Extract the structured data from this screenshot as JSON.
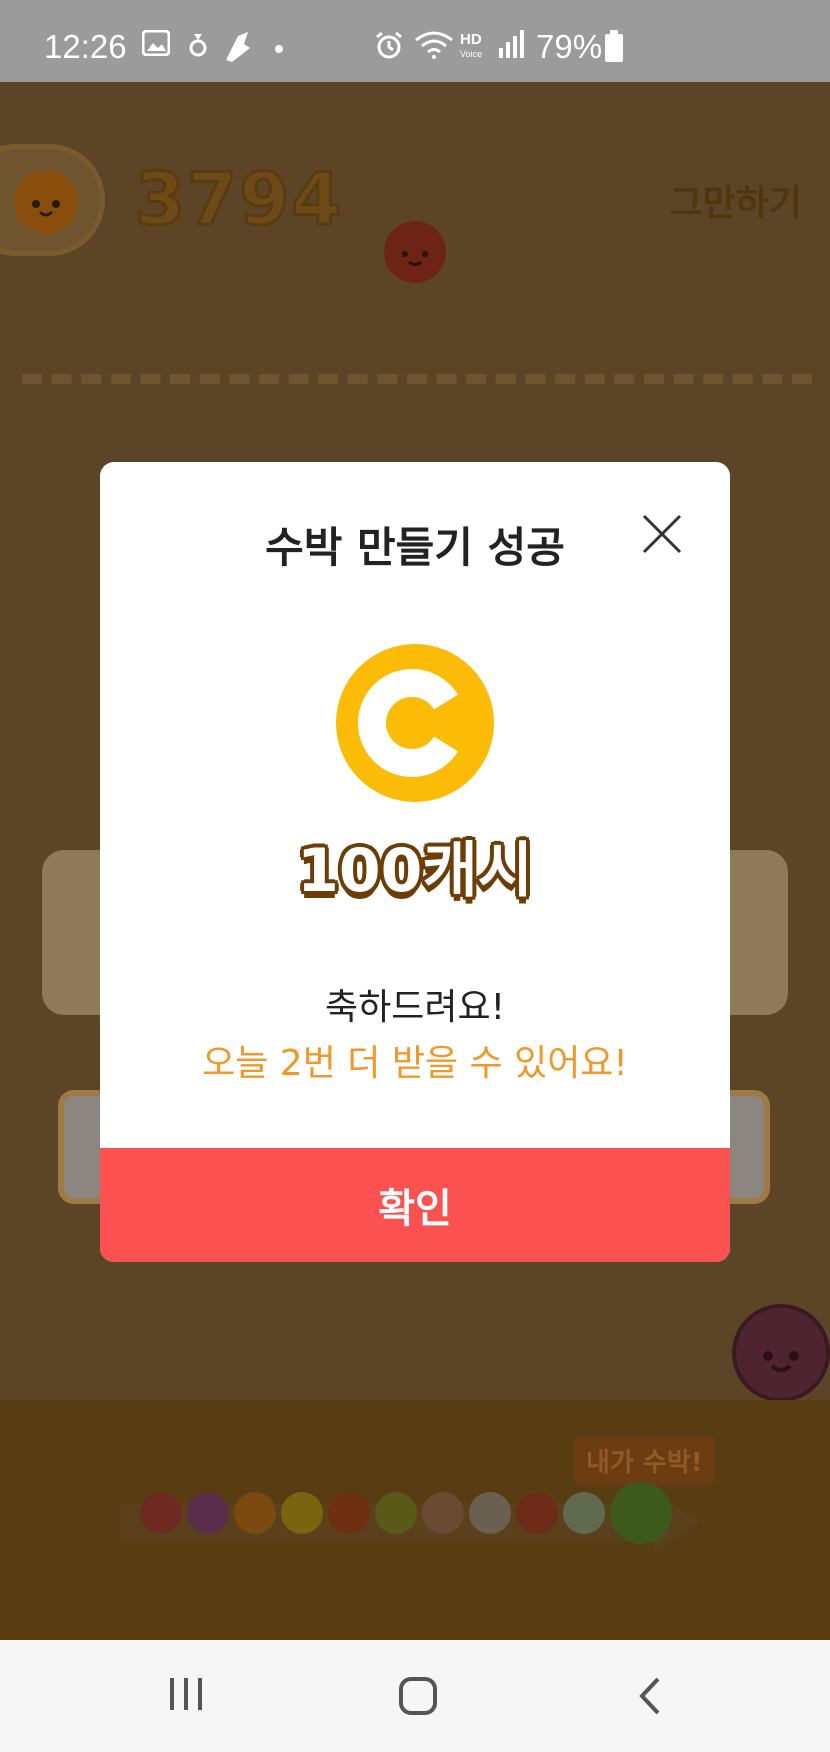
{
  "status_bar": {
    "time": "12:26",
    "battery": "79%",
    "icons": [
      "gallery-icon",
      "notification-icon",
      "app-icon",
      "dot-icon",
      "alarm-icon",
      "wifi-icon",
      "hd-voice-icon",
      "signal-icon",
      "battery-icon"
    ]
  },
  "game": {
    "score": "3794",
    "quit_label": "그만하기",
    "tag_label": "내가 수박!",
    "fruit_colors": [
      "#6e2a20",
      "#5a2e4a",
      "#7a4a10",
      "#7a6410",
      "#6e3010",
      "#5a5a18",
      "#6a4a30",
      "#6a6050",
      "#6e2a18",
      "#5f6a50",
      "#3d5a1c"
    ]
  },
  "modal": {
    "title": "수박 만들기 성공",
    "reward": "100캐시",
    "congrats": "축하드려요!",
    "remaining": "오늘 2번 더 받을 수 있어요!",
    "confirm_label": "확인",
    "coin_color": "#fbbb06"
  },
  "navbar": {
    "icons": [
      "recent-apps-icon",
      "home-icon",
      "back-icon"
    ]
  }
}
